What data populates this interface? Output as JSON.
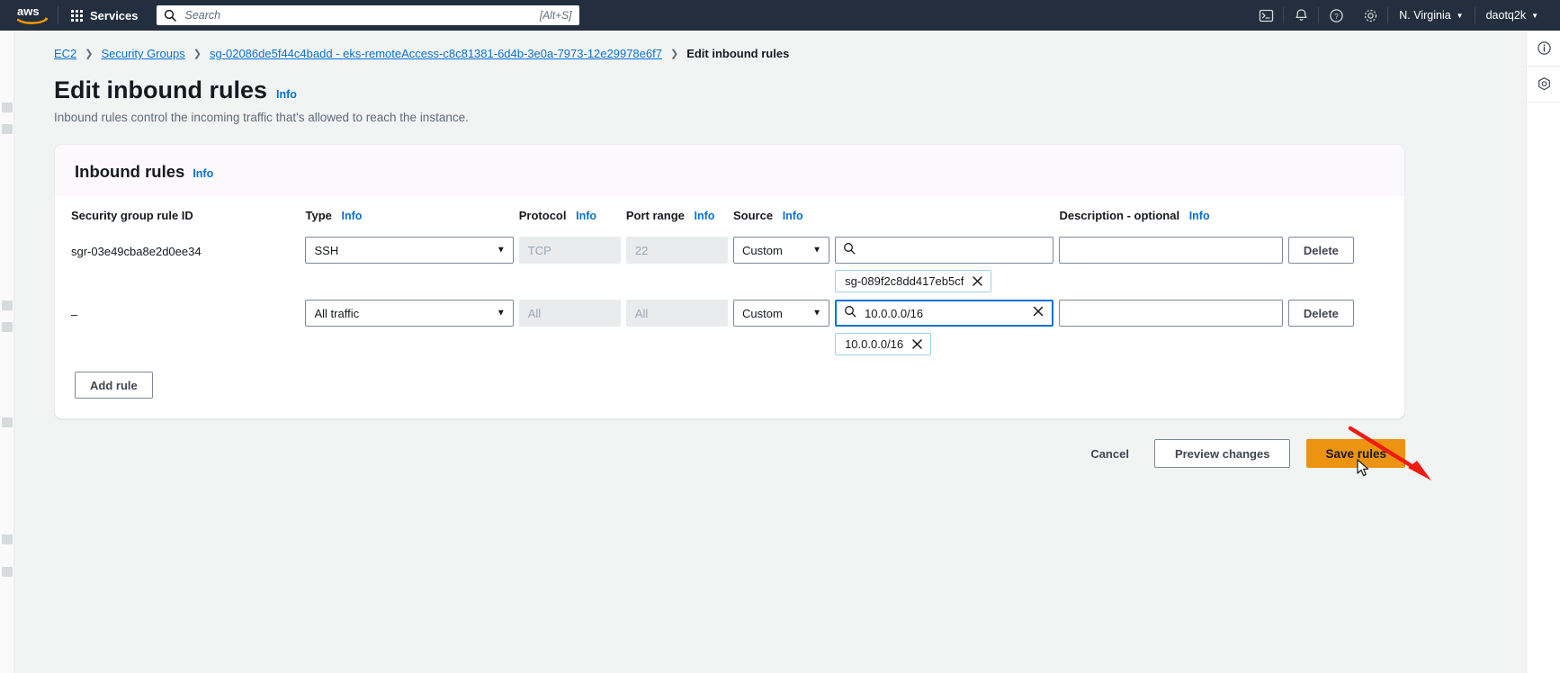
{
  "topnav": {
    "logo_alt": "aws",
    "services_label": "Services",
    "search_placeholder": "Search",
    "search_value": "",
    "search_shortcut": "[Alt+S]",
    "icons": [
      "cloudshell-icon",
      "notifications-icon",
      "help-icon",
      "settings-icon"
    ],
    "region_label": "N. Virginia",
    "account_label": "daotq2k"
  },
  "breadcrumb": {
    "items": [
      {
        "label": "EC2",
        "current": false
      },
      {
        "label": "Security Groups",
        "current": false
      },
      {
        "label": "sg-02086de5f44c4badd - eks-remoteAccess-c8c81381-6d4b-3e0a-7973-12e29978e6f7",
        "current": false
      },
      {
        "label": "Edit inbound rules",
        "current": true
      }
    ],
    "separator": "❯"
  },
  "page": {
    "title": "Edit inbound rules",
    "title_info": "Info",
    "subtitle": "Inbound rules control the incoming traffic that's allowed to reach the instance."
  },
  "card": {
    "heading": "Inbound rules",
    "heading_info": "Info",
    "columns": [
      {
        "label": "Security group rule ID",
        "info": ""
      },
      {
        "label": "Type",
        "info": "Info"
      },
      {
        "label": "Protocol",
        "info": "Info"
      },
      {
        "label": "Port range",
        "info": "Info"
      },
      {
        "label": "Source",
        "info": "Info"
      },
      {
        "label": "Description - optional",
        "info": "Info"
      }
    ],
    "rows": [
      {
        "rule_id": "sgr-03e49cba8e2d0ee34",
        "type": "SSH",
        "protocol": "TCP",
        "port_range": "22",
        "source_type": "Custom",
        "source_value": "",
        "source_focused": false,
        "source_chip": "sg-089f2c8dd417eb5cf",
        "description": "",
        "delete_label": "Delete"
      },
      {
        "rule_id": "–",
        "type": "All traffic",
        "protocol": "All",
        "port_range": "All",
        "source_type": "Custom",
        "source_value": "10.0.0.0/16",
        "source_focused": true,
        "source_chip": "10.0.0.0/16",
        "description": "",
        "delete_label": "Delete"
      }
    ],
    "add_rule_label": "Add rule"
  },
  "footer": {
    "cancel_label": "Cancel",
    "preview_label": "Preview changes",
    "save_label": "Save rules"
  },
  "rightrail": {
    "icons": [
      "info-panel-icon",
      "shortcuts-panel-icon"
    ]
  },
  "colors": {
    "nav_bg": "#232f3e",
    "link": "#0972d3",
    "primary_button": "#ec9411",
    "annotation_arrow": "#ee1b11",
    "page_bg": "#f2f3f3"
  }
}
